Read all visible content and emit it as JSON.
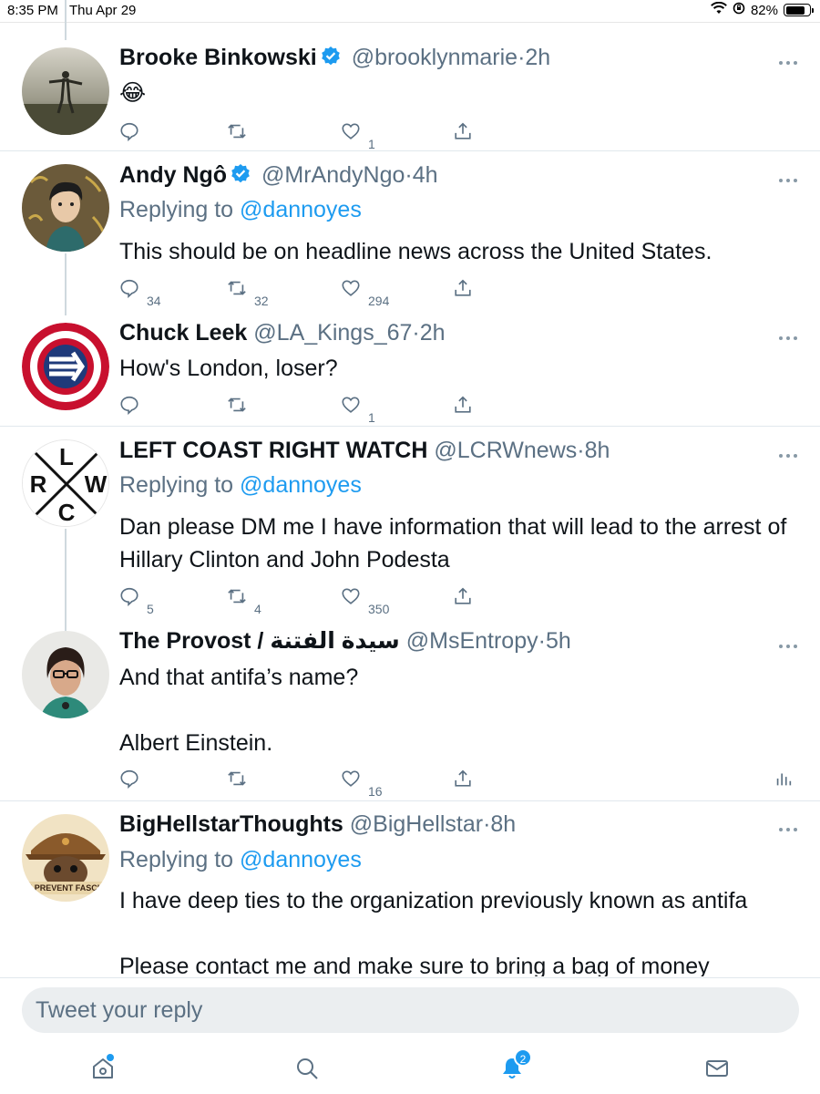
{
  "status_bar": {
    "time": "8:35 PM",
    "date": "Thu Apr 29",
    "battery": "82%",
    "battery_level": 0.82,
    "icons": [
      "wifi-icon",
      "orientation-lock-icon",
      "battery-icon"
    ]
  },
  "tweets": [
    {
      "name": "Brooke Binkowski",
      "verified": true,
      "handle": "@brooklynmarie",
      "sep": "·",
      "time": "2h",
      "replying_label": "",
      "replying_to": "",
      "text": "😂",
      "counts": {
        "reply": "",
        "retweet": "",
        "like": "1"
      }
    },
    {
      "name": "Andy Ngô",
      "verified": true,
      "handle": "@MrAndyNgo",
      "sep": "·",
      "time": "4h",
      "replying_label": "Replying to",
      "replying_to": "@dannoyes",
      "text": "This should be on headline news across the United States.",
      "counts": {
        "reply": "34",
        "retweet": "32",
        "like": "294"
      }
    },
    {
      "name": "Chuck Leek",
      "verified": false,
      "handle": "@LA_Kings_67",
      "sep": "·",
      "time": "2h",
      "replying_label": "",
      "replying_to": "",
      "text": "How's London, loser?",
      "counts": {
        "reply": "",
        "retweet": "",
        "like": "1"
      }
    },
    {
      "name": "LEFT COAST RIGHT WATCH",
      "verified": false,
      "handle": "@LCRWnews",
      "sep": "·",
      "time": "8h",
      "replying_label": "Replying to",
      "replying_to": "@dannoyes",
      "text": "Dan please DM me I have information that will lead to the arrest of Hillary Clinton and John Podesta",
      "counts": {
        "reply": "5",
        "retweet": "4",
        "like": "350"
      },
      "avatar_letters": [
        "L",
        "R",
        "W",
        "C"
      ]
    },
    {
      "name": "The Provost / سيدة الفتنة",
      "verified": false,
      "handle": "@MsEntropy",
      "sep": "·",
      "time": "5h",
      "replying_label": "",
      "replying_to": "",
      "text": "And that antifa’s name?\n\nAlbert Einstein.",
      "counts": {
        "reply": "",
        "retweet": "",
        "like": "16"
      }
    },
    {
      "name": "BigHellstarThoughts",
      "verified": false,
      "handle": "@BigHellstar",
      "sep": "·",
      "time": "8h",
      "replying_label": "Replying to",
      "replying_to": "@dannoyes",
      "text": "I have deep ties to the organization previously known as antifa\n\nPlease contact me and make sure to bring a bag of money",
      "counts": {
        "reply": "",
        "retweet": "",
        "like": ""
      },
      "avatar_text": "N PREVENT FASCIS"
    }
  ],
  "reply_box": {
    "placeholder": "Tweet your reply"
  },
  "tab_bar": {
    "items": [
      "home-icon",
      "search-icon",
      "notifications-icon",
      "messages-icon"
    ],
    "notifications_badge": "2"
  },
  "colors": {
    "accent": "#1d9bf0",
    "secondary_text": "#5b7083",
    "primary_text": "#0f1419",
    "divider": "#e1e8ed"
  }
}
